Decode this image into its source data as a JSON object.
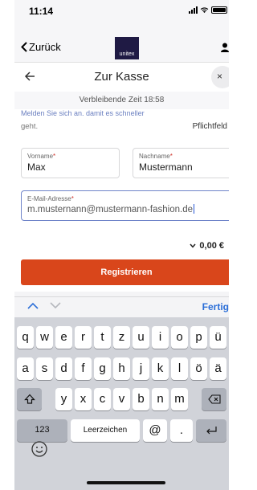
{
  "status": {
    "time": "11:14"
  },
  "header": {
    "back_label": "Zurück",
    "logo_text": "unitex"
  },
  "checkout": {
    "title": "Zur Kasse",
    "timer": "Verbleibende Zeit 18:58"
  },
  "form": {
    "login_hint": "Melden Sie sich an, damit es schneller",
    "login_hint_end": "geht.",
    "required_note": "Pflichtfeld",
    "first_name": {
      "label": "Vorname",
      "required_mark": "*",
      "value": "Max"
    },
    "last_name": {
      "label": "Nachname",
      "required_mark": "*",
      "value": "Mustermann"
    },
    "email": {
      "label": "E-Mail-Adresse",
      "required_mark": "*",
      "value": "m.musternann@mustermann-fashion.de"
    },
    "total": "0,00 €",
    "register_label": "Registrieren"
  },
  "keyboard": {
    "done_label": "Fertig",
    "row1": [
      "q",
      "w",
      "e",
      "r",
      "t",
      "z",
      "u",
      "i",
      "o",
      "p",
      "ü"
    ],
    "row2": [
      "a",
      "s",
      "d",
      "f",
      "g",
      "h",
      "j",
      "k",
      "l",
      "ö",
      "ä"
    ],
    "row3": [
      "y",
      "x",
      "c",
      "v",
      "b",
      "n",
      "m"
    ],
    "num_label": "123",
    "space_label": "Leerzeichen",
    "at_label": "@",
    "dot_label": "."
  },
  "colors": {
    "accent": "#d9461b",
    "link": "#2c6fd8",
    "logo_bg": "#1f1a44"
  }
}
